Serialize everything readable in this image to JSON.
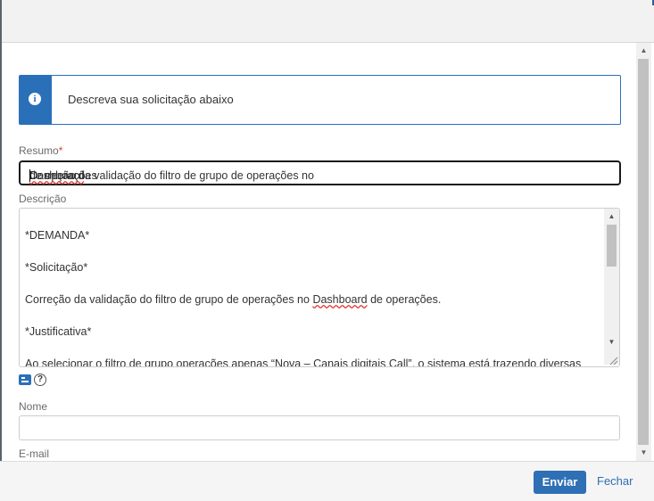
{
  "info_banner": {
    "icon": "info-icon",
    "text": "Descreva sua solicitação abaixo"
  },
  "resumo": {
    "label": "Resumo",
    "required_mark": "*",
    "value_pre": "Correção da validação do filtro de grupo de operações no ",
    "value_spell": "Dashboard",
    "value_post": " de operações"
  },
  "descricao": {
    "label": "Descrição",
    "lines": {
      "demanda": "*DEMANDA*",
      "solicitacao": "*Solicitação*",
      "body_pre": "Correção da validação do filtro de grupo de operações no ",
      "body_spell": "Dashboard",
      "body_post": " de operações.",
      "justificativa": "*Justificativa*",
      "cut": "Ao selecionar o filtro de grupo operações apenas “Nova – Canais digitais Call”, o sistema está trazendo diversas"
    }
  },
  "tools": {
    "help_glyph": "?"
  },
  "nome": {
    "label": "Nome",
    "value": ""
  },
  "email": {
    "label": "E-mail"
  },
  "footer": {
    "send_label": "Enviar",
    "close_label": "Fechar"
  },
  "colors": {
    "accent": "#2f6fb5",
    "required": "#d04437"
  }
}
